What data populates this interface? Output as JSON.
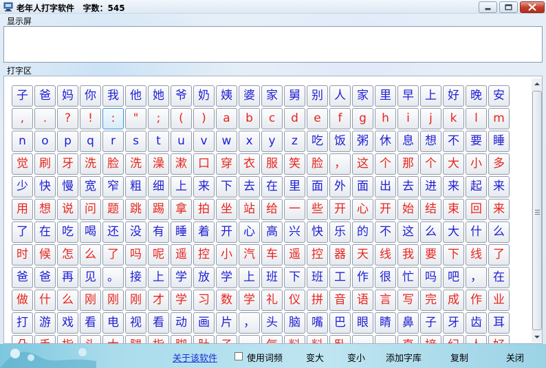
{
  "window": {
    "title": "老年人打字软件   字数：545"
  },
  "labels": {
    "display_screen": "显示屏",
    "typing_area": "打字区"
  },
  "display_screen": {
    "value": ""
  },
  "keyboard": {
    "focused_key": ":",
    "rows": [
      {
        "color": "blue",
        "keys": [
          "子",
          "爸",
          "妈",
          "你",
          "我",
          "他",
          "她",
          "爷",
          "奶",
          "姨",
          "婆",
          "家",
          "舅",
          "别",
          "人",
          "家",
          "里",
          "早",
          "上",
          "好",
          "晚",
          "安"
        ]
      },
      {
        "color": "red",
        "keys": [
          ",",
          ".",
          "?",
          "!",
          ":",
          "\"",
          ";",
          "(",
          ")",
          "a",
          "b",
          "c",
          "d",
          "e",
          "f",
          "g",
          "h",
          "i",
          "j",
          "k",
          "l",
          "m"
        ]
      },
      {
        "color": "blue",
        "keys": [
          "n",
          "o",
          "p",
          "q",
          "r",
          "s",
          "t",
          "u",
          "v",
          "w",
          "x",
          "y",
          "z",
          "吃",
          "饭",
          "粥",
          "休",
          "息",
          "想",
          "不",
          "要",
          "睡"
        ]
      },
      {
        "color": "red",
        "keys": [
          "觉",
          "刷",
          "牙",
          "洗",
          "脸",
          "洗",
          "澡",
          "漱",
          "口",
          "穿",
          "衣",
          "服",
          "笑",
          "脸",
          "，",
          "这",
          "个",
          "那",
          "个",
          "大",
          "小",
          "多"
        ]
      },
      {
        "color": "blue",
        "keys": [
          "少",
          "快",
          "慢",
          "宽",
          "窄",
          "粗",
          "细",
          "上",
          "来",
          "下",
          "去",
          "在",
          "里",
          "面",
          "外",
          "面",
          "出",
          "去",
          "进",
          "来",
          "起",
          "来"
        ]
      },
      {
        "color": "red",
        "keys": [
          "用",
          "想",
          "说",
          "问",
          "题",
          "跳",
          "踢",
          "拿",
          "拍",
          "坐",
          "站",
          "给",
          "一",
          "些",
          "开",
          "心",
          "开",
          "始",
          "结",
          "束",
          "回",
          "来"
        ]
      },
      {
        "color": "blue",
        "keys": [
          "了",
          "在",
          "吃",
          "喝",
          "还",
          "没",
          "有",
          "睡",
          "着",
          "开",
          "心",
          "高",
          "兴",
          "快",
          "乐",
          "的",
          "不",
          "这",
          "么",
          "大",
          "什",
          "么"
        ]
      },
      {
        "color": "red",
        "keys": [
          "时",
          "候",
          "怎",
          "么",
          "了",
          "吗",
          "呢",
          "遥",
          "控",
          "小",
          "汽",
          "车",
          "遥",
          "控",
          "器",
          "天",
          "线",
          "我",
          "要",
          "下",
          "线",
          "了"
        ]
      },
      {
        "color": "blue",
        "keys": [
          "爸",
          "爸",
          "再",
          "见",
          "。",
          "接",
          "上",
          "学",
          "放",
          "学",
          "上",
          "班",
          "下",
          "班",
          "工",
          "作",
          "很",
          "忙",
          "吗",
          "吧",
          "，",
          "在"
        ]
      },
      {
        "color": "red",
        "keys": [
          "做",
          "什",
          "么",
          "刚",
          "刚",
          "刚",
          "才",
          "学",
          "习",
          "数",
          "学",
          "礼",
          "仪",
          "拼",
          "音",
          "语",
          "言",
          "写",
          "完",
          "成",
          "作",
          "业"
        ]
      },
      {
        "color": "blue",
        "keys": [
          "打",
          "游",
          "戏",
          "看",
          "电",
          "视",
          "看",
          "动",
          "画",
          "片",
          "，",
          "头",
          "脑",
          "嘴",
          "巴",
          "眼",
          "睛",
          "鼻",
          "子",
          "牙",
          "齿",
          "耳"
        ]
      },
      {
        "color": "red",
        "keys": [
          "朵",
          "手",
          "指",
          "头",
          "大",
          "腿",
          "指",
          "脚",
          "肚",
          "子",
          "，",
          "气",
          "料",
          "料",
          "卧",
          "·",
          "·",
          "直",
          "接",
          "纪",
          "人",
          "好"
        ]
      }
    ]
  },
  "bottombar": {
    "about_label": "关于该软件",
    "use_frequency_label": "使用词频",
    "use_frequency_checked": false,
    "bigger_label": "变大",
    "smaller_label": "变小",
    "add_library_label": "添加字库",
    "copy_label": "复制",
    "close_label": "关闭"
  },
  "colors": {
    "key_blue": "#1e1ed2",
    "key_red": "#e8241b",
    "close_button": "#c4402d",
    "link": "#1d2fd6"
  },
  "icons": {
    "app": "computer-icon",
    "minimize": "minimize-icon",
    "maximize": "maximize-icon",
    "close": "close-icon"
  }
}
